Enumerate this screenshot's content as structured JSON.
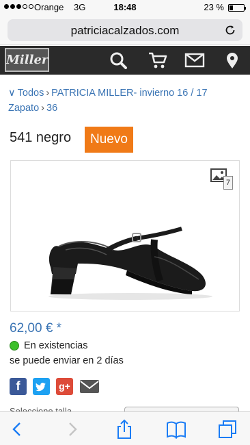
{
  "status_bar": {
    "carrier": "Orange",
    "network": "3G",
    "time": "18:48",
    "battery_percent_label": "23 %",
    "battery_level": 0.23
  },
  "browser": {
    "url": "patriciacalzados.com",
    "reload_icon": "reload-icon"
  },
  "site_header": {
    "logo_text": "Miller",
    "icons": [
      "search-icon",
      "cart-icon",
      "mail-icon",
      "location-icon"
    ]
  },
  "breadcrumb": {
    "items": [
      "Todos",
      "PATRICIA MILLER- invierno 16 / 17",
      "Zapato",
      "36"
    ]
  },
  "product": {
    "title": "541 negro",
    "badge": "Nuevo",
    "image_count": "7",
    "price": "62,00 € *",
    "stock_status": "En existencias",
    "shipping": "se puede enviar en 2 días"
  },
  "social": {
    "facebook": "f",
    "google_plus": "g+"
  },
  "partial_text": "Seleccione talla",
  "colors": {
    "accent_orange": "#f07a17",
    "link_blue": "#3a74b4",
    "header_dark": "#2a2a2a",
    "stock_green": "#3cbf2b"
  },
  "toolbar": {
    "icons": [
      "back-icon",
      "forward-icon",
      "share-icon",
      "bookmarks-icon",
      "tabs-icon"
    ]
  }
}
